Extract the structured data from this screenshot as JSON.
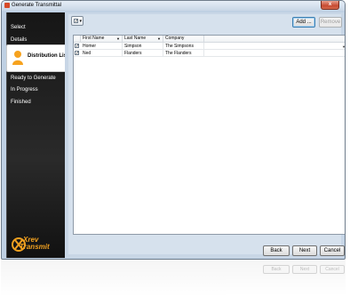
{
  "window": {
    "title": "Generate Transmittal",
    "close_label": "x"
  },
  "sidebar": {
    "items": [
      {
        "label": "Select"
      },
      {
        "label": "Details"
      },
      {
        "label": "Distribution List",
        "active": true
      },
      {
        "label": "Ready to Generate"
      },
      {
        "label": "In Progress"
      },
      {
        "label": "Finished"
      }
    ],
    "logo": {
      "line1": "Xrev",
      "line2": "Transmit"
    }
  },
  "toolbar": {
    "check_glyph": "✓",
    "caret_glyph": "▾",
    "add_label": "Add ...",
    "remove_label": "Remove"
  },
  "grid": {
    "columns": [
      {
        "label": "First Name",
        "sort": "▼"
      },
      {
        "label": "Last Name",
        "sort": "▼"
      },
      {
        "label": "Company",
        "sort": ""
      }
    ],
    "rows": [
      {
        "checked": true,
        "first": "Homer",
        "last": "Simpson",
        "company": "The Simpsons"
      },
      {
        "checked": true,
        "first": "Ned",
        "last": "Flanders",
        "company": "The Flanders"
      }
    ],
    "check_glyph": "✓",
    "scroll_glyph": "▼"
  },
  "footer": {
    "back_label": "Back",
    "next_label": "Next",
    "cancel_label": "Cancel"
  },
  "colors": {
    "sidebar_bg": "#1a1a1a",
    "accent": "#3c7fb1",
    "close": "#c64a31",
    "logo": "#f0a020"
  }
}
